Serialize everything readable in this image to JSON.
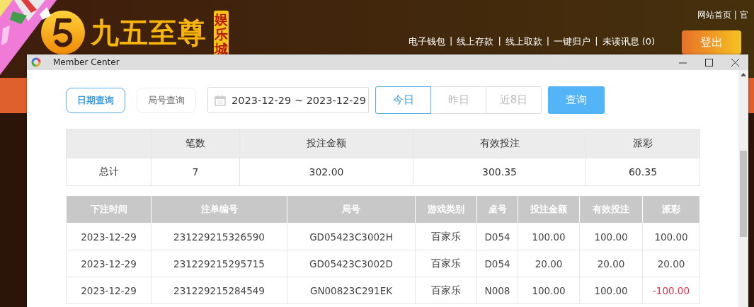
{
  "site": {
    "logo_text": "九五至尊",
    "logo_badge": "娱乐城",
    "top_link": "网站首页 | 官",
    "separator": "|",
    "nav_links": [
      "电子钱包",
      "线上存款",
      "线上取款",
      "一键归户",
      "未读讯息 (0)"
    ],
    "logout": "登出"
  },
  "window": {
    "title": "Member Center"
  },
  "query": {
    "modes": [
      {
        "label": "日期查询",
        "selected": true
      },
      {
        "label": "局号查询",
        "selected": false
      }
    ],
    "date_range": "2023-12-29 ~ 2023-12-29",
    "periods": [
      {
        "label": "今日",
        "selected": true
      },
      {
        "label": "昨日",
        "selected": false
      },
      {
        "label": "近8日",
        "selected": false
      }
    ],
    "search_button": "查询"
  },
  "summary": {
    "columns": [
      "笔数",
      "投注金额",
      "有效投注",
      "派彩"
    ],
    "row_label": "总计",
    "values": [
      "7",
      "302.00",
      "300.35",
      "60.35"
    ]
  },
  "bets": {
    "columns": [
      "下注时间",
      "注单编号",
      "局号",
      "游戏类别",
      "桌号",
      "投注金额",
      "有效投注",
      "派彩"
    ],
    "rows": [
      {
        "cells": [
          "2023-12-29",
          "231229215326590",
          "GD05423C3002H",
          "百家乐",
          "D054",
          "100.00",
          "100.00",
          "100.00"
        ],
        "negative": false
      },
      {
        "cells": [
          "2023-12-29",
          "231229215295715",
          "GD05423C3002D",
          "百家乐",
          "D054",
          "20.00",
          "20.00",
          "20.00"
        ],
        "negative": false
      },
      {
        "cells": [
          "2023-12-29",
          "231229215284549",
          "GN00823C291EK",
          "百家乐",
          "N008",
          "100.00",
          "100.00",
          "-100.00"
        ],
        "negative": true
      }
    ]
  }
}
